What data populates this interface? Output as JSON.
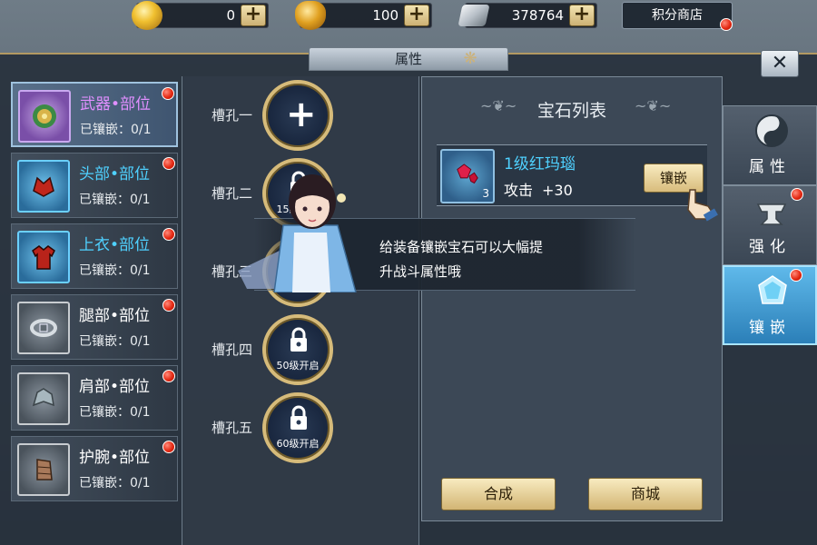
{
  "currency": {
    "gold": "0",
    "ingot": "100",
    "silver": "378764",
    "plus_label": "+"
  },
  "shop": {
    "label": "积分商店"
  },
  "window": {
    "title": "属性",
    "close_label": "✕"
  },
  "slots": [
    {
      "name": "武器•部位",
      "status": "已镶嵌：0/1",
      "name_color": "purple"
    },
    {
      "name": "头部•部位",
      "status": "已镶嵌：0/1",
      "name_color": "blue"
    },
    {
      "name": "上衣•部位",
      "status": "已镶嵌：0/1",
      "name_color": "blue"
    },
    {
      "name": "腿部•部位",
      "status": "已镶嵌：0/1",
      "name_color": "white"
    },
    {
      "name": "肩部•部位",
      "status": "已镶嵌：0/1",
      "name_color": "white"
    },
    {
      "name": "护腕•部位",
      "status": "已镶嵌：0/1",
      "name_color": "white"
    }
  ],
  "sockets": [
    {
      "label": "槽孔一",
      "state": "open",
      "plus": "+"
    },
    {
      "label": "槽孔二",
      "state": "locked",
      "lock_text": "15级开启"
    },
    {
      "label": "槽孔三",
      "state": "locked",
      "lock_text": "开启"
    },
    {
      "label": "槽孔四",
      "state": "locked",
      "lock_text": "50级开启"
    },
    {
      "label": "槽孔五",
      "state": "locked",
      "lock_text": "60级开启"
    }
  ],
  "gem_panel": {
    "title": "宝石列表",
    "gem": {
      "name": "1级红玛瑙",
      "count": "3",
      "stat_name": "攻击",
      "stat_value": "+30",
      "inlay_label": "镶嵌"
    },
    "merge_label": "合成",
    "mall_label": "商城"
  },
  "tabs": [
    {
      "label": "属性",
      "icon": "yin-yang-icon"
    },
    {
      "label": "强化",
      "icon": "anvil-icon"
    },
    {
      "label": "镶嵌",
      "icon": "gem-icon"
    }
  ],
  "tip": {
    "line1": "给装备镶嵌宝石可以大幅提",
    "line2": "升战斗属性哦"
  },
  "colors": {
    "accent_gold": "#d6bb7a",
    "name_purple": "#e08fff",
    "name_blue": "#4fd1ff",
    "active_tab": "#2b7fb8",
    "red_dot": "#e52a14"
  }
}
